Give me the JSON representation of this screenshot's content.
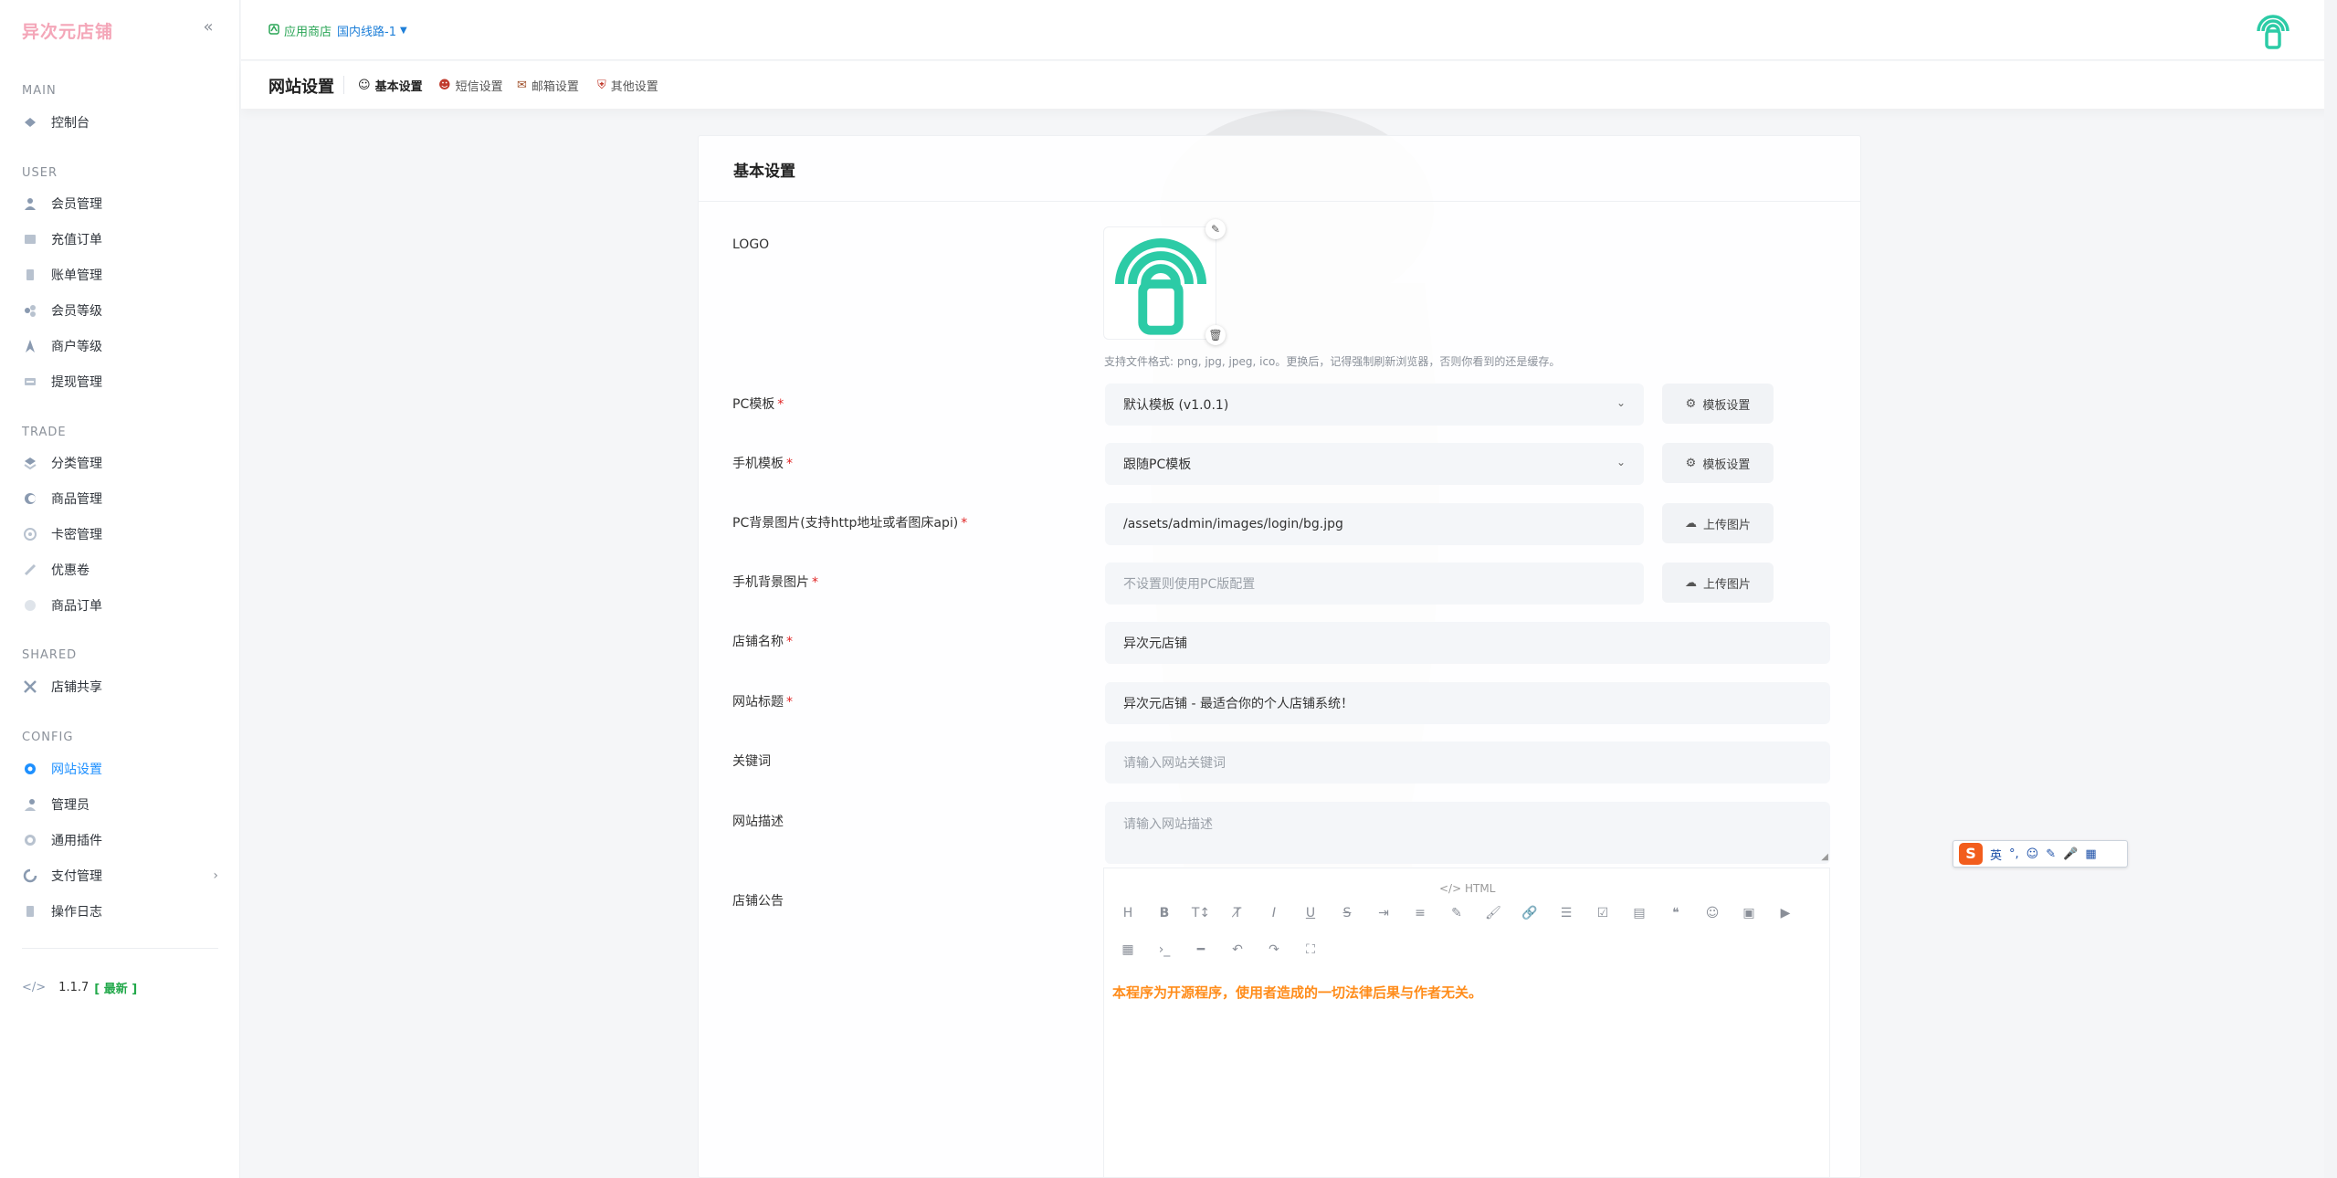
{
  "brand": "异次元店铺",
  "sidebar": {
    "sections": [
      {
        "title": "MAIN",
        "items": [
          {
            "label": "控制台",
            "icon": "dashboard-icon"
          }
        ]
      },
      {
        "title": "USER",
        "items": [
          {
            "label": "会员管理",
            "icon": "user-icon"
          },
          {
            "label": "充值订单",
            "icon": "recharge-icon"
          },
          {
            "label": "账单管理",
            "icon": "bill-icon"
          },
          {
            "label": "会员等级",
            "icon": "level-icon"
          },
          {
            "label": "商户等级",
            "icon": "merchant-icon"
          },
          {
            "label": "提现管理",
            "icon": "withdraw-icon"
          }
        ]
      },
      {
        "title": "TRADE",
        "items": [
          {
            "label": "分类管理",
            "icon": "category-icon"
          },
          {
            "label": "商品管理",
            "icon": "goods-icon"
          },
          {
            "label": "卡密管理",
            "icon": "card-icon"
          },
          {
            "label": "优惠卷",
            "icon": "coupon-icon"
          },
          {
            "label": "商品订单",
            "icon": "order-icon"
          }
        ]
      },
      {
        "title": "SHARED",
        "items": [
          {
            "label": "店铺共享",
            "icon": "share-icon"
          }
        ]
      },
      {
        "title": "CONFIG",
        "items": [
          {
            "label": "网站设置",
            "icon": "gear-icon",
            "active": true
          },
          {
            "label": "管理员",
            "icon": "admin-icon"
          },
          {
            "label": "通用插件",
            "icon": "plugin-icon"
          },
          {
            "label": "支付管理",
            "icon": "payment-icon",
            "has_arrow": true
          },
          {
            "label": "操作日志",
            "icon": "log-icon"
          }
        ]
      }
    ],
    "version": "1.1.7",
    "version_badge": "[ 最新 ]"
  },
  "topbar": {
    "store_label": "应用商店",
    "line_label": "国内线路-1"
  },
  "subbar": {
    "title": "网站设置",
    "tabs": [
      {
        "label": "基本设置",
        "active": true
      },
      {
        "label": "短信设置"
      },
      {
        "label": "邮箱设置"
      },
      {
        "label": "其他设置"
      }
    ]
  },
  "form": {
    "card_title": "基本设置",
    "logo_label": "LOGO",
    "logo_hint": "支持文件格式: png, jpg, jpeg, ico。更换后，记得强制刷新浏览器，否则你看到的还是缓存。",
    "pc_template": {
      "label": "PC模板",
      "value": "默认模板 (v1.0.1)",
      "button": "模板设置"
    },
    "mobile_template": {
      "label": "手机模板",
      "value": "跟随PC模板",
      "button": "模板设置"
    },
    "pc_bg": {
      "label": "PC背景图片(支持http地址或者图床api)",
      "value": "/assets/admin/images/login/bg.jpg",
      "button": "上传图片"
    },
    "mobile_bg": {
      "label": "手机背景图片",
      "placeholder": "不设置则使用PC版配置",
      "button": "上传图片"
    },
    "shop_name": {
      "label": "店铺名称",
      "value": "异次元店铺"
    },
    "site_title": {
      "label": "网站标题",
      "value": "异次元店铺 - 最适合你的个人店铺系统！"
    },
    "keywords": {
      "label": "关键词",
      "placeholder": "请输入网站关键词"
    },
    "description": {
      "label": "网站描述",
      "placeholder": "请输入网站描述"
    },
    "notice": {
      "label": "店铺公告",
      "html_toggle": "HTML",
      "content": "本程序为开源程序，使用者造成的一切法律后果与作者无关。"
    }
  },
  "ime": {
    "lang": "英"
  },
  "colors": {
    "accent": "#1e90ff",
    "brand": "#f4a6b8",
    "logo": "#2ccba6",
    "notice": "#ff8c1a",
    "required": "#e02424"
  }
}
